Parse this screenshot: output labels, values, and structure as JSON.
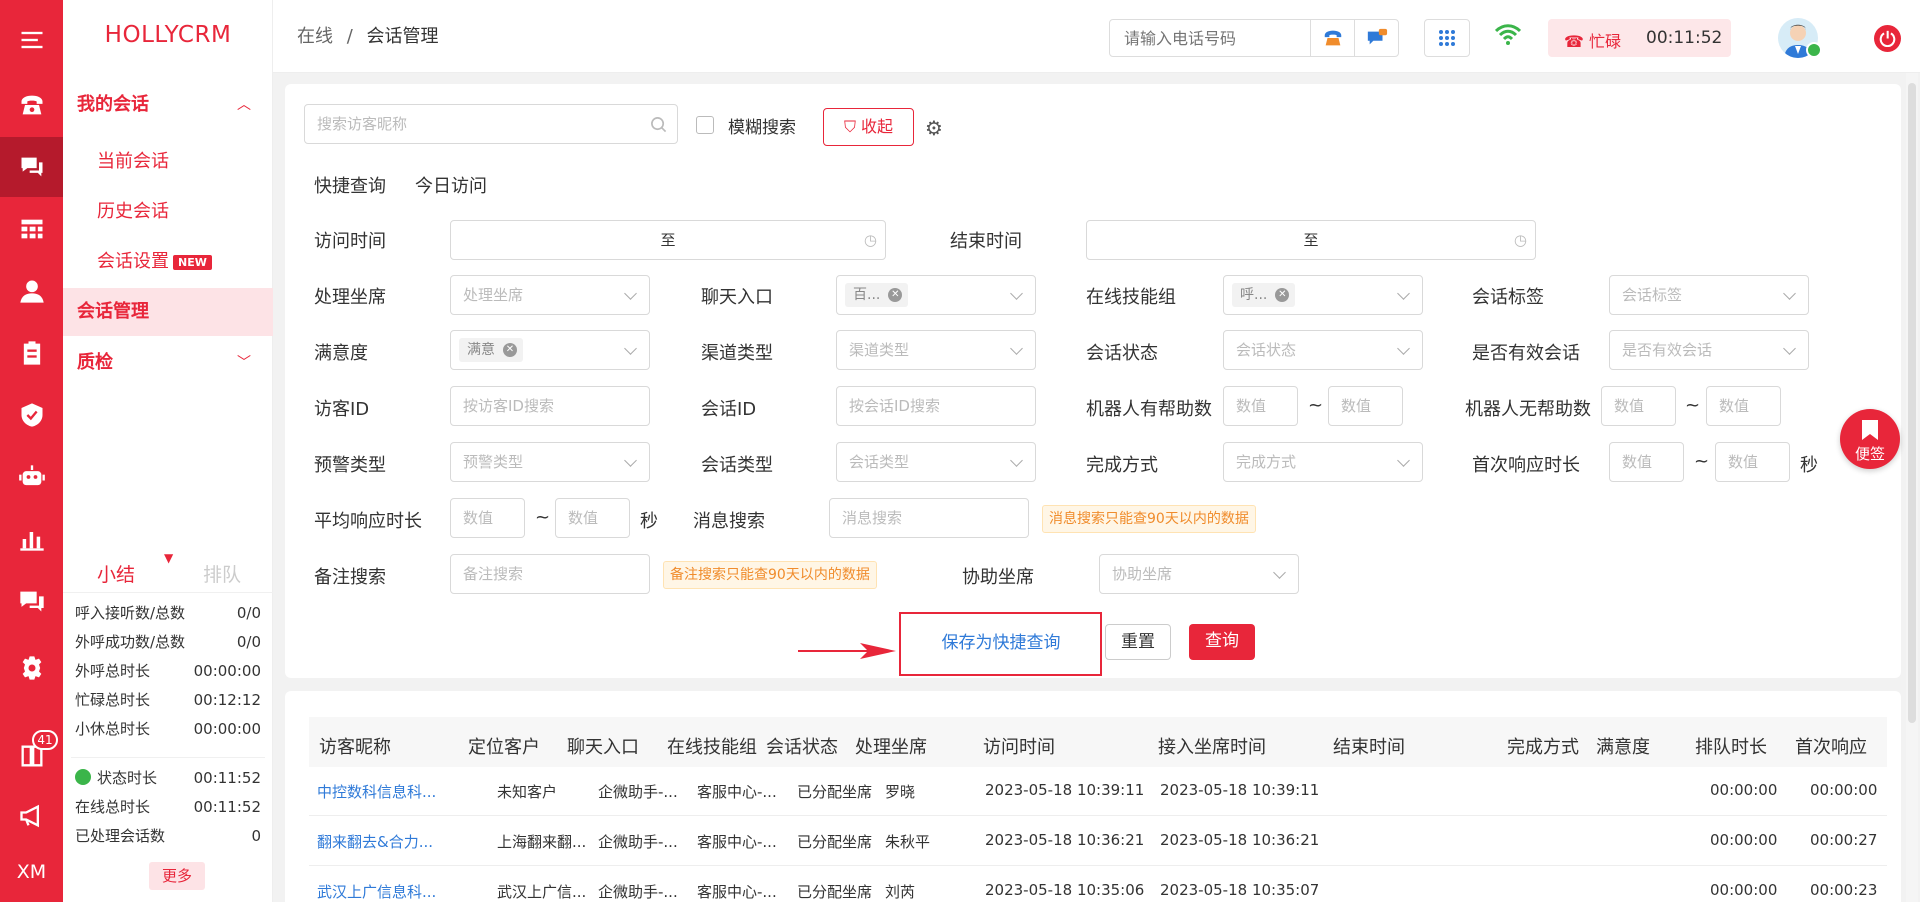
{
  "app": {
    "brand": "HOLLYCRM"
  },
  "rail": {
    "badge_count": "41",
    "user_initials": "XM"
  },
  "sidebar": {
    "my_sessions": "我的会话",
    "current": "当前会话",
    "history": "历史会话",
    "settings": "会话设置",
    "new_badge": "NEW",
    "session_mgmt": "会话管理",
    "qc": "质检"
  },
  "stats": {
    "tab_summary": "小结",
    "tab_queue": "排队",
    "rows": [
      {
        "label": "呼入接听数/总数",
        "value": "0/0"
      },
      {
        "label": "外呼成功数/总数",
        "value": "0/0"
      },
      {
        "label": "外呼总时长",
        "value": "00:00:00"
      },
      {
        "label": "忙碌总时长",
        "value": "00:12:12"
      },
      {
        "label": "小休总时长",
        "value": "00:00:00"
      },
      {
        "label": "状态时长",
        "value": "00:11:52"
      },
      {
        "label": "在线总时长",
        "value": "00:11:52"
      },
      {
        "label": "已处理会话数",
        "value": "0"
      }
    ],
    "more": "更多"
  },
  "topbar": {
    "crumb_root": "在线",
    "crumb_sep": "/",
    "crumb_current": "会话管理",
    "phone_placeholder": "请输入电话号码",
    "status_label": "忙碌",
    "status_time": "00:11:52"
  },
  "filter": {
    "search_placeholder": "搜索访客昵称",
    "fuzzy": "模糊搜索",
    "collapse": "收起",
    "quick_query": "快捷查询",
    "today_visit": "今日访问",
    "visit_time": "访问时间",
    "to": "至",
    "end_time": "结束时间",
    "agent": "处理坐席",
    "agent_ph": "处理坐席",
    "chat_entry": "聊天入口",
    "chat_entry_tag": "百...",
    "skill_group": "在线技能组",
    "skill_group_tag": "呼...",
    "session_tag": "会话标签",
    "session_tag_ph": "会话标签",
    "satisfaction": "满意度",
    "satisfaction_tag": "满意",
    "channel_type": "渠道类型",
    "channel_type_ph": "渠道类型",
    "session_status": "会话状态",
    "session_status_ph": "会话状态",
    "valid_session": "是否有效会话",
    "valid_session_ph": "是否有效会话",
    "visitor_id": "访客ID",
    "visitor_id_ph": "按访客ID搜索",
    "session_id": "会话ID",
    "session_id_ph": "按会话ID搜索",
    "bot_helpful": "机器人有帮助数",
    "bot_unhelpful": "机器人无帮助数",
    "value_ph": "数值",
    "tilde": "~",
    "alert_type": "预警类型",
    "alert_type_ph": "预警类型",
    "session_type": "会话类型",
    "session_type_ph": "会话类型",
    "finish_way": "完成方式",
    "finish_way_ph": "完成方式",
    "first_resp": "首次响应时长",
    "sec": "秒",
    "avg_resp": "平均响应时长",
    "msg_search": "消息搜索",
    "msg_search_ph": "消息搜索",
    "msg_warn": "消息搜索只能查90天以内的数据",
    "remark_search": "备注搜索",
    "remark_ph": "备注搜索",
    "remark_warn": "备注搜索只能查90天以内的数据",
    "assist_agent": "协助坐席",
    "assist_agent_ph": "协助坐席",
    "save_quick": "保存为快捷查询",
    "reset": "重置",
    "query": "查询"
  },
  "table": {
    "headers": [
      "访客昵称",
      "定位客户",
      "聊天入口",
      "在线技能组",
      "会话状态",
      "处理坐席",
      "访问时间",
      "接入坐席时间",
      "结束时间",
      "完成方式",
      "满意度",
      "排队时长",
      "首次响应"
    ],
    "rows": [
      [
        "中控数科信息科...",
        "未知客户",
        "企微助手-...",
        "客服中心-...",
        "已分配坐席",
        "罗晓",
        "2023-05-18 10:39:11",
        "2023-05-18 10:39:11",
        "",
        "",
        "",
        "00:00:00",
        "00:00:00"
      ],
      [
        "翻来翻去&合力...",
        "上海翻来翻...",
        "企微助手-...",
        "客服中心-...",
        "已分配坐席",
        "朱秋平",
        "2023-05-18 10:36:21",
        "2023-05-18 10:36:21",
        "",
        "",
        "",
        "00:00:00",
        "00:00:27"
      ],
      [
        "武汉上广信息科...",
        "武汉上广信...",
        "企微助手-...",
        "客服中心-...",
        "已分配坐席",
        "刘芮",
        "2023-05-18 10:35:06",
        "2023-05-18 10:35:07",
        "",
        "",
        "",
        "00:00:00",
        "00:00:23"
      ]
    ]
  },
  "float": {
    "note": "便签"
  },
  "colors": {
    "brand": "#e8263a",
    "link": "#2f7ad8",
    "warn": "#f08c2c"
  }
}
